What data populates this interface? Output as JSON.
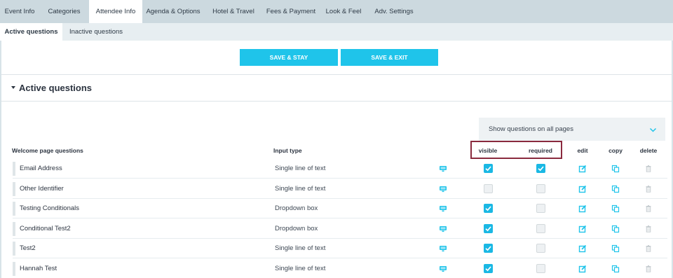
{
  "top_tabs": [
    "Event Info",
    "Categories",
    "Attendee Info",
    "Agenda & Options",
    "Hotel & Travel",
    "Fees & Payment",
    "Look & Feel",
    "Adv. Settings"
  ],
  "sub_tabs": [
    "Active questions",
    "Inactive questions"
  ],
  "buttons": {
    "save_stay": "SAVE & STAY",
    "save_exit": "SAVE & EXIT"
  },
  "section_title": "Active questions",
  "filter": {
    "selected": "Show questions on all pages"
  },
  "table": {
    "headers": {
      "name": "Welcome page questions",
      "input_type": "Input type",
      "visible": "visible",
      "required": "required",
      "edit": "edit",
      "copy": "copy",
      "delete": "delete"
    },
    "rows": [
      {
        "name": "Email Address",
        "type": "Single line of text",
        "visible": true,
        "required": true
      },
      {
        "name": "Other Identifier",
        "type": "Single line of text",
        "visible": false,
        "required": false
      },
      {
        "name": "Testing Conditionals",
        "type": "Dropdown box",
        "visible": true,
        "required": false
      },
      {
        "name": "Conditional Test2",
        "type": "Dropdown box",
        "visible": true,
        "required": false
      },
      {
        "name": "Test2",
        "type": "Single line of text",
        "visible": true,
        "required": false
      },
      {
        "name": "Hannah Test",
        "type": "Single line of text",
        "visible": true,
        "required": false
      }
    ]
  },
  "icons": {
    "display": "monitor-icon",
    "edit": "edit-icon",
    "copy": "copy-icon",
    "delete": "trash-icon",
    "filter_chevron": "chevron-down-icon",
    "section_toggle": "caret-down-icon"
  },
  "colors": {
    "accent": "#1fc4ea",
    "checkbox_on": "#1ab8e4",
    "highlight_border": "#8a2a3e",
    "top_bar": "#ccd9df"
  }
}
